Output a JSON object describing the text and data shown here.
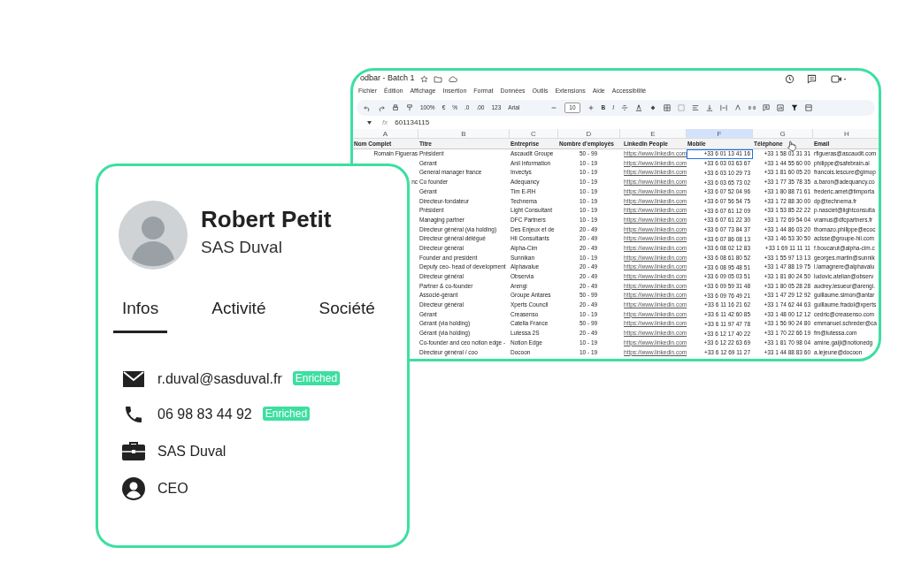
{
  "sheet": {
    "title": "odbar - Batch 1",
    "menu": [
      "Fichier",
      "Édition",
      "Affichage",
      "Insertion",
      "Format",
      "Données",
      "Outils",
      "Extensions",
      "Aide",
      "Accessibilité"
    ],
    "toolbar": {
      "zoom": "100%",
      "currency": "€",
      "percent": "%",
      "decrease_decimals": ".0",
      "increase_decimals": ".00",
      "number_format": "123",
      "font": "Arial",
      "font_size": "10",
      "bold": "B",
      "italic": "I"
    },
    "formula": {
      "fx": "fx",
      "value": "601134115"
    },
    "column_letters": [
      "A",
      "B",
      "C",
      "D",
      "E",
      "F",
      "G",
      "H"
    ],
    "headers": [
      "Nom Complet",
      "Titre",
      "Entreprise",
      "Nombre d'employés",
      "LinkedIn People",
      "Mobile",
      "Téléphone",
      "Email"
    ],
    "rows": [
      {
        "name": "Romain Figueras",
        "title": "Président",
        "company": "Ascaudit Groupe",
        "employees": "50 - 99",
        "linkedin": "https://www.linkedin.com",
        "mobile": "+33 6 01 13 41 16",
        "phone": "+33 1 58 01 31 31",
        "email": "rfigueras@ascaudit.com",
        "selected": true
      },
      {
        "title": "Gérant",
        "company": "Anil Information",
        "employees": "10 - 19",
        "linkedin": "https://www.linkedin.com",
        "mobile": "+33 6 03 03 63 67",
        "phone": "+33 1 44 55 60 00",
        "email": "philippe@safebrain.ai",
        "selected": false
      },
      {
        "title": "General manager france",
        "company": "Invectys",
        "employees": "10 - 19",
        "linkedin": "https://www.linkedin.com",
        "mobile": "+33 6 03 10 29 73",
        "phone": "+33 1 81 60 05 20",
        "email": "francois.lescure@gimop",
        "selected": false
      },
      {
        "name": "nc",
        "title": "Co founder",
        "company": "Adequancy",
        "employees": "10 - 19",
        "linkedin": "https://www.linkedin.com",
        "mobile": "+33 6 03 65 73 02",
        "phone": "+33 1 77 35 78 35",
        "email": "a.baron@adequancy.co",
        "selected": false
      },
      {
        "title": "Gérant",
        "company": "Tim E-RH",
        "employees": "10 - 19",
        "linkedin": "https://www.linkedin.com",
        "mobile": "+33 6 07 52 04 96",
        "phone": "+33 1 80 88 71 61",
        "email": "frederic.amet@timporta",
        "selected": false
      },
      {
        "title": "Directeur-fondateur",
        "company": "Technema",
        "employees": "10 - 19",
        "linkedin": "https://www.linkedin.com",
        "mobile": "+33 6 07 56 54 75",
        "phone": "+33 1 72 88 30 00",
        "email": "dp@technema.fr",
        "selected": false
      },
      {
        "title": "Président",
        "company": "Light Consultant",
        "employees": "10 - 19",
        "linkedin": "https://www.linkedin.com",
        "mobile": "+33 6 07 61 12 09",
        "phone": "+33 1 53 85 22 22",
        "email": "p.nasciet@lightconsulta",
        "selected": false
      },
      {
        "title": "Managing partner",
        "company": "DFC Partners",
        "employees": "10 - 19",
        "linkedin": "https://www.linkedin.com",
        "mobile": "+33 6 07 61 22 30",
        "phone": "+33 1 72 69 54 04",
        "email": "vramus@dfcpartners.fr",
        "selected": false
      },
      {
        "title": "Directeur général (via holding)",
        "company": "Des Enjeux et de",
        "employees": "20 - 49",
        "linkedin": "https://www.linkedin.com",
        "mobile": "+33 6 07 73 84 37",
        "phone": "+33 1 44 86 03 20",
        "email": "thomazo.philippe@ecoc",
        "selected": false
      },
      {
        "title": "Directeur général délégué",
        "company": "Hli Consultants",
        "employees": "20 - 49",
        "linkedin": "https://www.linkedin.com",
        "mobile": "+33 6 07 86 08 13",
        "phone": "+33 1 46 53 30 50",
        "email": "acisse@groupe-hii.com",
        "selected": false
      },
      {
        "title": "Directeur général",
        "company": "Alpha-Cim",
        "employees": "20 - 49",
        "linkedin": "https://www.linkedin.com",
        "mobile": "+33 6 08 02 12 83",
        "phone": "+33 1 69 11 11 11",
        "email": "f.boucarut@alpha-cim.c",
        "selected": false
      },
      {
        "title": "Founder and president",
        "company": "Sunnikan",
        "employees": "10 - 19",
        "linkedin": "https://www.linkedin.com",
        "mobile": "+33 6 08 61 80 52",
        "phone": "+33 1 55 97 13 13",
        "email": "georges.martin@sunnik",
        "selected": false
      },
      {
        "title": "Deputy ceo- head of development",
        "company": "Alphavalue",
        "employees": "20 - 49",
        "linkedin": "https://www.linkedin.com",
        "mobile": "+33 6 08 95 48 51",
        "phone": "+33 1 47 88 19 75",
        "email": "l.lamagnere@alphavalu",
        "selected": false
      },
      {
        "title": "Directeur général",
        "company": "Observia",
        "employees": "20 - 49",
        "linkedin": "https://www.linkedin.com",
        "mobile": "+33 6 09 05 03 51",
        "phone": "+33 1 81 80 24 50",
        "email": "ludovic.atelian@observ",
        "selected": false
      },
      {
        "title": "Partner & co-founder",
        "company": "Arengi",
        "employees": "20 - 49",
        "linkedin": "https://www.linkedin.com",
        "mobile": "+33 6 09 59 31 48",
        "phone": "+33 1 80 05 28 28",
        "email": "audrey.lesueur@arengi.",
        "selected": false
      },
      {
        "title": "Associé-gérant",
        "company": "Groupe Antares",
        "employees": "50 - 99",
        "linkedin": "https://www.linkedin.com",
        "mobile": "+33 6 09 76 49 21",
        "phone": "+33 1 47 29 12 92",
        "email": "guillaume.simon@antar",
        "selected": false
      },
      {
        "title": "Directeur général",
        "company": "Xperts Council",
        "employees": "20 - 49",
        "linkedin": "https://www.linkedin.com",
        "mobile": "+33 6 11 16 21 62",
        "phone": "+33 1 74 62 44 63",
        "email": "guillaume.fradol@xperts",
        "selected": false
      },
      {
        "title": "Gérant",
        "company": "Creasenso",
        "employees": "10 - 19",
        "linkedin": "https://www.linkedin.com",
        "mobile": "+33 6 11 42 60 85",
        "phone": "+33 1 48 00 12 12",
        "email": "cedric@creasenso.com",
        "selected": false
      },
      {
        "title": "Gérant (via holding)",
        "company": "Catella France",
        "employees": "50 - 99",
        "linkedin": "https://www.linkedin.com",
        "mobile": "+33 6 11 97 47 78",
        "phone": "+33 1 56 90 24 80",
        "email": "emmanuel.schreder@ca",
        "selected": false
      },
      {
        "title": "Gérant (via holding)",
        "company": "Lutessa 2S",
        "employees": "20 - 49",
        "linkedin": "https://www.linkedin.com",
        "mobile": "+33 6 12 17 40 22",
        "phone": "+33 1 70 22 66 19",
        "email": "fm@lutessa.com",
        "selected": false
      },
      {
        "title": "Co-founder and ceo notion edge -",
        "company": "Notion Edge",
        "employees": "10 - 19",
        "linkedin": "https://www.linkedin.com",
        "mobile": "+33 6 12 22 63 69",
        "phone": "+33 1 81 70 98 04",
        "email": "amine.gaiji@notionedg",
        "selected": false
      },
      {
        "title": "Directeur général / coo",
        "company": "Docoon",
        "employees": "10 - 19",
        "linkedin": "https://www.linkedin.com",
        "mobile": "+33 6 12 69 11 27",
        "phone": "+33 1 44 88 83 60",
        "email": "a.lejeune@docoon",
        "selected": false
      }
    ]
  },
  "card": {
    "name": "Robert Petit",
    "company": "SAS Duval",
    "tabs": [
      {
        "label": "Infos",
        "selected": true
      },
      {
        "label": "Activité",
        "selected": false
      },
      {
        "label": "Société",
        "selected": false
      }
    ],
    "fields": [
      {
        "kind": "email",
        "value": "r.duval@sasduval.fr",
        "badge": "Enriched"
      },
      {
        "kind": "phone",
        "value": "06 98 83 44 92",
        "badge": "Enriched"
      },
      {
        "kind": "company",
        "value": "SAS Duval"
      },
      {
        "kind": "role",
        "value": "CEO"
      }
    ]
  }
}
